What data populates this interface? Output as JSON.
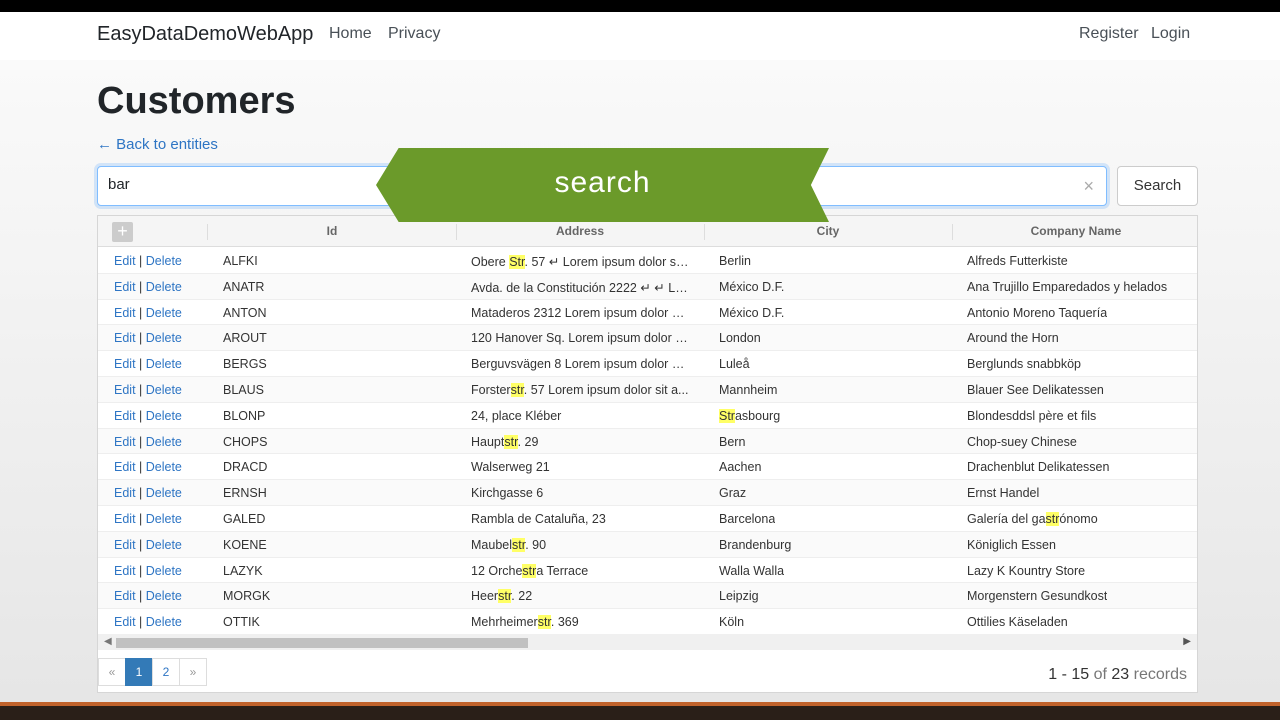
{
  "navbar": {
    "brand": "EasyDataDemoWebApp",
    "links": [
      "Home",
      "Privacy"
    ],
    "right_links": [
      "Register",
      "Login"
    ]
  },
  "page": {
    "title": "Customers",
    "back_link": "← Back to entities"
  },
  "search": {
    "value": "bar",
    "clear_icon": "×",
    "button_label": "Search"
  },
  "overlay": {
    "label": "search"
  },
  "grid": {
    "add_icon": "+",
    "columns": [
      "Id",
      "Address",
      "City",
      "Company Name"
    ],
    "edit_label": "Edit",
    "separator": "|",
    "delete_label": "Delete",
    "rows": [
      {
        "id": "ALFKI",
        "address": "Obere Str. 57 ↵ Lorem ipsum dolor sit ...",
        "city": "Berlin",
        "company": "Alfreds Futterkiste"
      },
      {
        "id": "ANATR",
        "address": "Avda. de la Constitución 2222 ↵ ↵ Lor...",
        "city": "México D.F.",
        "company": "Ana Trujillo Emparedados y helados"
      },
      {
        "id": "ANTON",
        "address": "Mataderos 2312 Lorem ipsum dolor sit...",
        "city": "México D.F.",
        "company": "Antonio Moreno Taquería"
      },
      {
        "id": "AROUT",
        "address": "120 Hanover Sq. Lorem ipsum dolor si...",
        "city": "London",
        "company": "Around the Horn"
      },
      {
        "id": "BERGS",
        "address": "Berguvsvägen 8 Lorem ipsum dolor sit...",
        "city": "Luleå",
        "company": "Berglunds snabbköp"
      },
      {
        "id": "BLAUS",
        "address": "Forsterstr. 57 Lorem ipsum dolor sit a...",
        "city": "Mannheim",
        "company": "Blauer See Delikatessen"
      },
      {
        "id": "BLONP",
        "address": "24, place Kléber",
        "city": "Strasbourg",
        "company": "Blondesddsl père et fils"
      },
      {
        "id": "CHOPS",
        "address": "Hauptstr. 29",
        "city": "Bern",
        "company": "Chop-suey Chinese"
      },
      {
        "id": "DRACD",
        "address": "Walserweg 21",
        "city": "Aachen",
        "company": "Drachenblut Delikatessen"
      },
      {
        "id": "ERNSH",
        "address": "Kirchgasse 6",
        "city": "Graz",
        "company": "Ernst Handel"
      },
      {
        "id": "GALED",
        "address": "Rambla de Cataluña, 23",
        "city": "Barcelona",
        "company": "Galería del gastrónomo"
      },
      {
        "id": "KOENE",
        "address": "Maubelstr. 90",
        "city": "Brandenburg",
        "company": "Königlich Essen"
      },
      {
        "id": "LAZYK",
        "address": "12 Orchestra Terrace",
        "city": "Walla Walla",
        "company": "Lazy K Kountry Store"
      },
      {
        "id": "MORGK",
        "address": "Heerstr. 22",
        "city": "Leipzig",
        "company": "Morgenstern Gesundkost"
      },
      {
        "id": "OTTIK",
        "address": "Mehrheimerstr. 369",
        "city": "Köln",
        "company": "Ottilies Käseladen"
      }
    ]
  },
  "scroll": {
    "left_arrow": "◀",
    "right_arrow": "▶"
  },
  "pagination": {
    "prev": "«",
    "pages": [
      "1",
      "2"
    ],
    "next": "»",
    "records_from": "1",
    "records_dash": "-",
    "records_to": "15",
    "records_of": "of",
    "records_total": "23",
    "records_word": "records"
  },
  "colors": {
    "accent": "#337ab7",
    "link": "#2e75c4",
    "banner": "#6b9a2a",
    "highlight": "#ffff66"
  }
}
